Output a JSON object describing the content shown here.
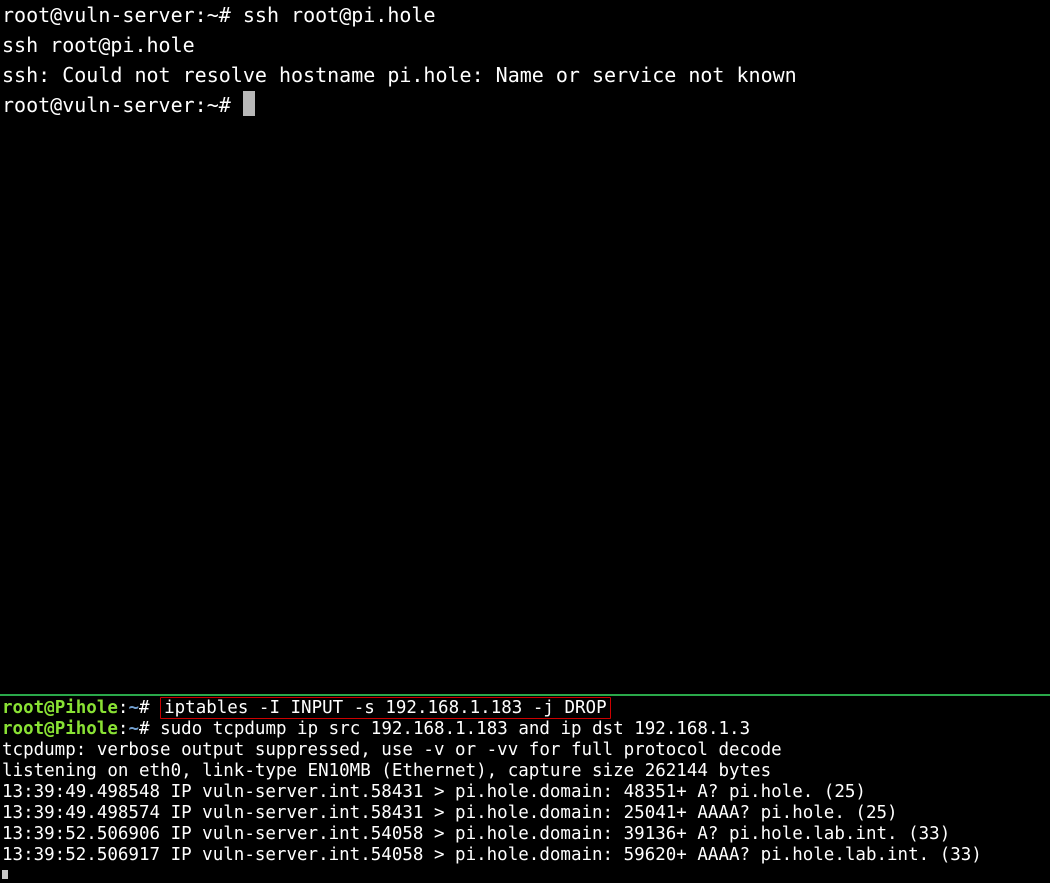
{
  "top": {
    "lines": [
      {
        "type": "prompt",
        "user": "root",
        "host": "vuln-server",
        "path": "~",
        "hash": "#",
        "cmd": "ssh root@pi.hole",
        "cursor": false
      },
      {
        "type": "out",
        "text": "ssh root@pi.hole"
      },
      {
        "type": "out",
        "text": "ssh: Could not resolve hostname pi.hole: Name or service not known"
      },
      {
        "type": "prompt",
        "user": "root",
        "host": "vuln-server",
        "path": "~",
        "hash": "#",
        "cmd": "",
        "cursor": true
      }
    ]
  },
  "bottom": {
    "lines": [
      {
        "type": "prompt",
        "user": "root",
        "host": "Pihole",
        "path": "~",
        "hash": "#",
        "cmd": "iptables -I INPUT -s 192.168.1.183 -j DROP",
        "highlight": true
      },
      {
        "type": "prompt",
        "user": "root",
        "host": "Pihole",
        "path": "~",
        "hash": "#",
        "cmd": "sudo tcpdump ip src 192.168.1.183 and ip dst 192.168.1.3",
        "highlight": false
      },
      {
        "type": "out",
        "text": "tcpdump: verbose output suppressed, use -v or -vv for full protocol decode"
      },
      {
        "type": "out",
        "text": "listening on eth0, link-type EN10MB (Ethernet), capture size 262144 bytes"
      },
      {
        "type": "out",
        "text": "13:39:49.498548 IP vuln-server.int.58431 > pi.hole.domain: 48351+ A? pi.hole. (25)"
      },
      {
        "type": "out",
        "text": "13:39:49.498574 IP vuln-server.int.58431 > pi.hole.domain: 25041+ AAAA? pi.hole. (25)"
      },
      {
        "type": "out",
        "text": "13:39:52.506906 IP vuln-server.int.54058 > pi.hole.domain: 39136+ A? pi.hole.lab.int. (33)"
      },
      {
        "type": "out",
        "text": "13:39:52.506917 IP vuln-server.int.54058 > pi.hole.domain: 59620+ AAAA? pi.hole.lab.int. (33)"
      }
    ]
  }
}
